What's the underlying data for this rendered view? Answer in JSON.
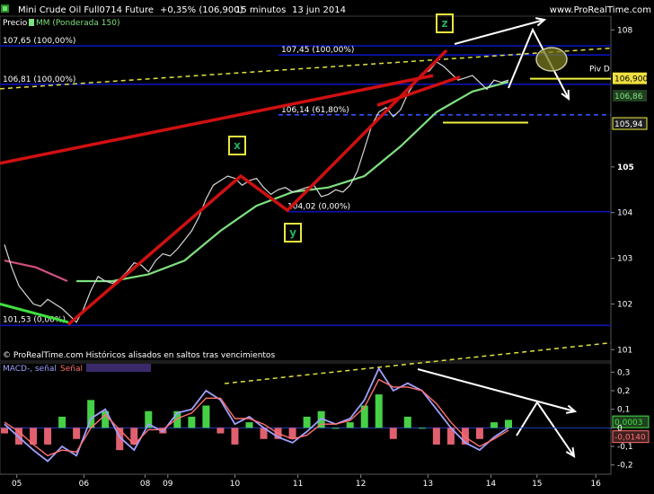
{
  "header": {
    "instrument": "Mini Crude Oil Full0714 Future",
    "change": "+0,35% (106,900)",
    "timeframe": "15 minutos",
    "date": "13 jun 2014",
    "website": "www.ProRealTime.com"
  },
  "price_panel": {
    "legend_price": "Precio",
    "legend_ma": "MM (Ponderada 150)",
    "footer_note": "© ProRealTime.com Históricos alisados en saltos tras vencimientos"
  },
  "macd_panel": {
    "legend_macd": "MACD-, señal",
    "legend_signal": "Señal",
    "current_values": [
      "0,0003",
      "-0,0140"
    ]
  },
  "colors": {
    "background": "#000000",
    "price": "#d8d8d8",
    "ma": "#7fe07f",
    "level_line": "#0a14b4",
    "fib_line": "#3050ff",
    "trend_dashed": "#e0e040",
    "zigzag": "#d01010",
    "arrow": "#ffffff",
    "macd_line": "#a0a0ff",
    "signal_line": "#ff7070",
    "hist_pos": "#46d046",
    "hist_neg": "#e06070",
    "label_box": "#e8e840",
    "label_text": "#20b060"
  },
  "chart_data": [
    {
      "type": "line",
      "title": "Mini Crude Oil Full0714 Future",
      "x_tick_labels": [
        "05",
        "06",
        "08",
        "09",
        "10",
        "11",
        "12",
        "13",
        "14",
        "15",
        "16"
      ],
      "y_tick_labels": [
        "101",
        "102",
        "103",
        "104",
        "105",
        "108"
      ],
      "ylim": [
        100.75,
        108.3
      ],
      "price_labels": [
        "106,900",
        "106,86",
        "105,94"
      ],
      "pivot_label": "Piv D",
      "levels": [
        {
          "label": "107,65 (100,00%)",
          "value": 107.65
        },
        {
          "label": "107,45 (100,00%)",
          "value": 107.45
        },
        {
          "label": "106,81 (100,00%)",
          "value": 106.81
        },
        {
          "label": "106,14 (61,80%)",
          "value": 106.14
        },
        {
          "label": "104,02 (0,00%)",
          "value": 104.02
        },
        {
          "label": "101,53 (0,00%)",
          "value": 101.53
        }
      ],
      "wave_labels": [
        "x",
        "y",
        "z"
      ],
      "series": [
        {
          "x": [
            0,
            1,
            2,
            3,
            4,
            5,
            6,
            7,
            8,
            9,
            10,
            11,
            12,
            13,
            14,
            15,
            16,
            17,
            18,
            19,
            20,
            21,
            22,
            23,
            24,
            25,
            26,
            27,
            28,
            29,
            30,
            31,
            32,
            33,
            34,
            35,
            36,
            37,
            38,
            39,
            40,
            41,
            42,
            43,
            44,
            45,
            46,
            47,
            48,
            49,
            50,
            51,
            52,
            53,
            54,
            55,
            56,
            57,
            58,
            59,
            60,
            61,
            62,
            63,
            64,
            65,
            66,
            67,
            68,
            69,
            70
          ],
          "values": [
            103.3,
            102.8,
            102.4,
            102.2,
            102.0,
            101.95,
            102.1,
            102.0,
            101.9,
            101.75,
            101.6,
            101.9,
            102.3,
            102.6,
            102.5,
            102.45,
            102.55,
            102.7,
            102.9,
            102.85,
            102.7,
            102.95,
            103.1,
            103.05,
            103.2,
            103.4,
            103.6,
            103.9,
            104.3,
            104.6,
            104.7,
            104.8,
            104.75,
            104.6,
            104.7,
            104.75,
            104.55,
            104.4,
            104.5,
            104.55,
            104.45,
            104.5,
            104.55,
            104.6,
            104.35,
            104.4,
            104.5,
            104.45,
            104.6,
            104.9,
            105.4,
            105.9,
            106.2,
            106.3,
            106.1,
            106.25,
            106.6,
            106.85,
            107.05,
            107.1,
            107.3,
            107.2,
            107.05,
            106.9,
            106.95,
            107.0,
            106.85,
            106.7,
            106.9,
            106.85,
            106.9
          ],
          "type": "line"
        },
        {
          "x": [
            10,
            15,
            20,
            25,
            30,
            35,
            40,
            45,
            50,
            55,
            60,
            65,
            70
          ],
          "values": [
            102.5,
            102.5,
            102.65,
            102.95,
            103.6,
            104.15,
            104.45,
            104.55,
            104.8,
            105.45,
            106.2,
            106.65,
            106.86
          ],
          "type": "line"
        }
      ]
    },
    {
      "type": "line",
      "title": "MACD-, señal",
      "y_tick_labels": [
        "0,3",
        "0,2",
        "0,1",
        "0",
        "-0,1",
        "-0,2"
      ],
      "ylim": [
        -0.25,
        0.35
      ],
      "series": [
        {
          "x": [
            0,
            2,
            4,
            6,
            8,
            10,
            12,
            14,
            16,
            18,
            20,
            22,
            24,
            26,
            28,
            30,
            32,
            34,
            36,
            38,
            40,
            42,
            44,
            46,
            48,
            50,
            52,
            54,
            56,
            58,
            60,
            62,
            64,
            66,
            68,
            70
          ],
          "values": [
            0.02,
            -0.05,
            -0.12,
            -0.18,
            -0.1,
            -0.15,
            0.05,
            0.1,
            -0.05,
            -0.12,
            0.02,
            -0.02,
            0.08,
            0.1,
            0.2,
            0.15,
            0.02,
            0.06,
            0.0,
            -0.05,
            -0.08,
            -0.02,
            0.05,
            0.02,
            0.05,
            0.15,
            0.32,
            0.2,
            0.24,
            0.2,
            0.1,
            0.0,
            -0.08,
            -0.12,
            -0.05,
            0.0003
          ]
        },
        {
          "x": [
            0,
            2,
            4,
            6,
            8,
            10,
            12,
            14,
            16,
            18,
            20,
            22,
            24,
            26,
            28,
            30,
            32,
            34,
            36,
            38,
            40,
            42,
            44,
            46,
            48,
            50,
            52,
            54,
            56,
            58,
            60,
            62,
            64,
            66,
            68,
            70
          ],
          "values": [
            0.03,
            -0.02,
            -0.09,
            -0.15,
            -0.12,
            -0.13,
            0.0,
            0.07,
            -0.01,
            -0.09,
            -0.01,
            -0.01,
            0.05,
            0.08,
            0.16,
            0.16,
            0.05,
            0.05,
            0.02,
            -0.03,
            -0.06,
            -0.04,
            0.02,
            0.02,
            0.04,
            0.11,
            0.26,
            0.22,
            0.22,
            0.2,
            0.13,
            0.03,
            -0.05,
            -0.1,
            -0.06,
            -0.014
          ]
        }
      ]
    }
  ]
}
